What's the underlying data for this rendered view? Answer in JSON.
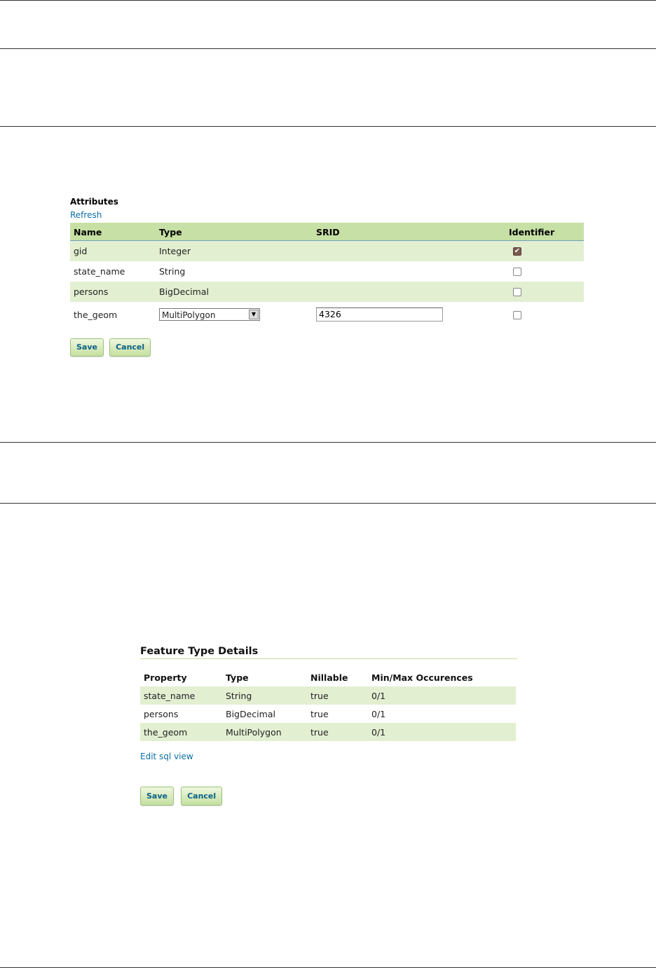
{
  "attributes": {
    "title": "Attributes",
    "refresh_label": "Refresh",
    "columns": [
      "Name",
      "Type",
      "SRID",
      "Identifier"
    ],
    "rows": [
      {
        "name": "gid",
        "type": "Integer",
        "identifier": true
      },
      {
        "name": "state_name",
        "type": "String",
        "identifier": false
      },
      {
        "name": "persons",
        "type": "BigDecimal",
        "identifier": false
      },
      {
        "name": "the_geom",
        "type_select": "MultiPolygon",
        "srid": "4326",
        "identifier": false
      }
    ],
    "save_label": "Save",
    "cancel_label": "Cancel"
  },
  "feature_type": {
    "title": "Feature Type Details",
    "columns": [
      "Property",
      "Type",
      "Nillable",
      "Min/Max Occurences"
    ],
    "rows": [
      {
        "property": "state_name",
        "type": "String",
        "nillable": "true",
        "occurences": "0/1"
      },
      {
        "property": "persons",
        "type": "BigDecimal",
        "nillable": "true",
        "occurences": "0/1"
      },
      {
        "property": "the_geom",
        "type": "MultiPolygon",
        "nillable": "true",
        "occurences": "0/1"
      }
    ],
    "edit_link": "Edit sql view",
    "save_label": "Save",
    "cancel_label": "Cancel"
  },
  "colors": {
    "header_green": "#c7e0a5",
    "row_green": "#e2efd1",
    "link_blue": "#0b6fa4"
  }
}
